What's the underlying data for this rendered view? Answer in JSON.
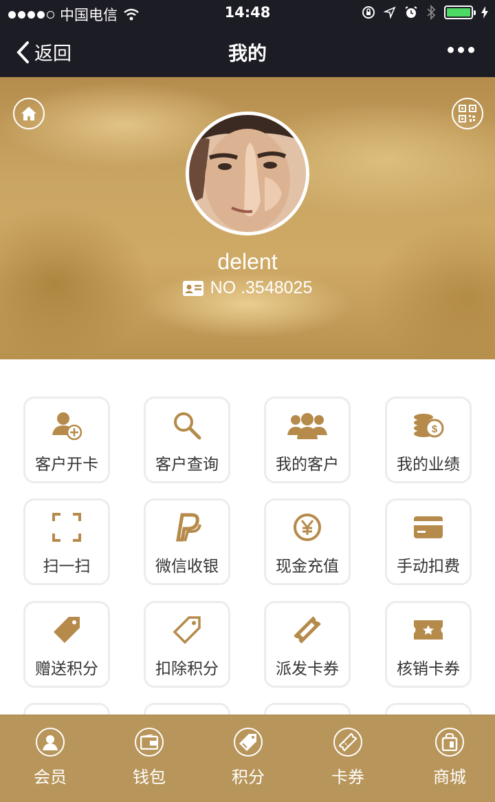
{
  "status_bar": {
    "carrier": "中国电信",
    "time": "14:48"
  },
  "nav": {
    "back_label": "返回",
    "title": "我的"
  },
  "profile": {
    "username": "delent",
    "member_no": "NO .3548025"
  },
  "grid_items": [
    {
      "label": "客户开卡",
      "icon": "add-user-icon"
    },
    {
      "label": "客户查询",
      "icon": "search-icon"
    },
    {
      "label": "我的客户",
      "icon": "users-icon"
    },
    {
      "label": "我的业绩",
      "icon": "coins-icon"
    },
    {
      "label": "扫一扫",
      "icon": "scan-icon"
    },
    {
      "label": "微信收银",
      "icon": "paypal-icon"
    },
    {
      "label": "现金充值",
      "icon": "yen-icon"
    },
    {
      "label": "手动扣费",
      "icon": "card-icon"
    },
    {
      "label": "赠送积分",
      "icon": "tag-filled-icon"
    },
    {
      "label": "扣除积分",
      "icon": "tag-outline-icon"
    },
    {
      "label": "派发卡券",
      "icon": "ticket-icon"
    },
    {
      "label": "核销卡券",
      "icon": "star-ticket-icon"
    }
  ],
  "tabbar": [
    {
      "label": "会员",
      "icon": "member-icon"
    },
    {
      "label": "钱包",
      "icon": "wallet-icon"
    },
    {
      "label": "积分",
      "icon": "points-tag-icon"
    },
    {
      "label": "卡券",
      "icon": "coupon-icon"
    },
    {
      "label": "商城",
      "icon": "shop-bag-icon"
    }
  ],
  "colors": {
    "accent": "#b8955a",
    "icon_gold": "#b58a4a",
    "dark_bar": "#1c1c24",
    "battery": "#4cd964"
  }
}
